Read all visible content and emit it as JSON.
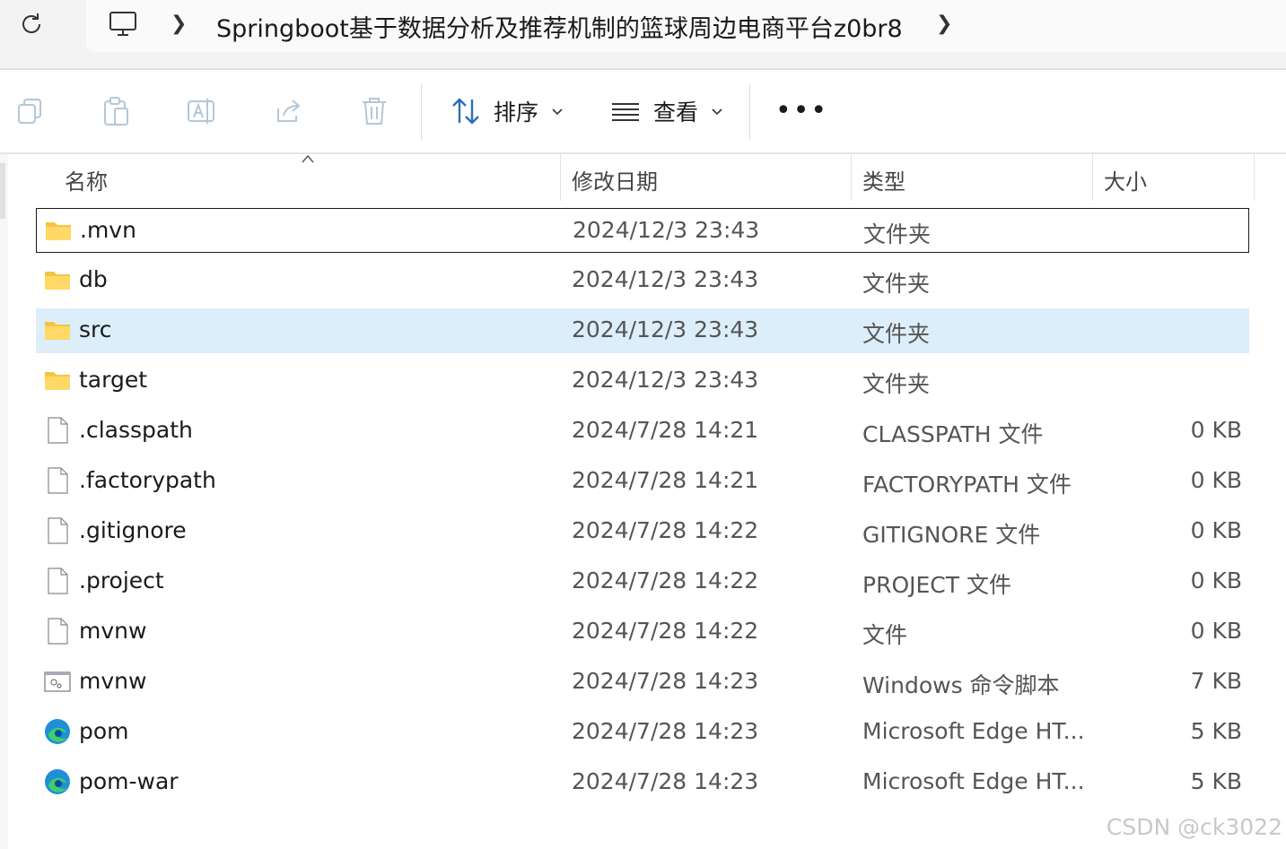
{
  "address": {
    "path_label": "Springboot基于数据分析及推荐机制的篮球周边电商平台z0br8",
    "icons": [
      "refresh-icon",
      "this-pc-icon",
      "chevron-right-icon"
    ]
  },
  "toolbar": {
    "sort_label": "排序",
    "view_label": "查看",
    "more_label": "•••",
    "icons": [
      "copy-icon",
      "paste-icon",
      "rename-icon",
      "share-icon",
      "delete-icon",
      "sort-icon",
      "view-icon"
    ]
  },
  "columns": {
    "name": "名称",
    "date": "修改日期",
    "type": "类型",
    "size": "大小"
  },
  "files": [
    {
      "name": ".mvn",
      "date": "2024/12/3 23:43",
      "type": "文件夹",
      "size": "",
      "icon": "folder-icon"
    },
    {
      "name": "db",
      "date": "2024/12/3 23:43",
      "type": "文件夹",
      "size": "",
      "icon": "folder-icon"
    },
    {
      "name": "src",
      "date": "2024/12/3 23:43",
      "type": "文件夹",
      "size": "",
      "icon": "folder-icon"
    },
    {
      "name": "target",
      "date": "2024/12/3 23:43",
      "type": "文件夹",
      "size": "",
      "icon": "folder-icon"
    },
    {
      "name": ".classpath",
      "date": "2024/7/28 14:21",
      "type": "CLASSPATH 文件",
      "size": "0 KB",
      "icon": "file-icon"
    },
    {
      "name": ".factorypath",
      "date": "2024/7/28 14:21",
      "type": "FACTORYPATH 文件",
      "size": "0 KB",
      "icon": "file-icon"
    },
    {
      "name": ".gitignore",
      "date": "2024/7/28 14:22",
      "type": "GITIGNORE 文件",
      "size": "0 KB",
      "icon": "file-icon"
    },
    {
      "name": ".project",
      "date": "2024/7/28 14:22",
      "type": "PROJECT 文件",
      "size": "0 KB",
      "icon": "file-icon"
    },
    {
      "name": "mvnw",
      "date": "2024/7/28 14:22",
      "type": "文件",
      "size": "0 KB",
      "icon": "file-icon"
    },
    {
      "name": "mvnw",
      "date": "2024/7/28 14:23",
      "type": "Windows 命令脚本",
      "size": "7 KB",
      "icon": "script-icon"
    },
    {
      "name": "pom",
      "date": "2024/7/28 14:23",
      "type": "Microsoft Edge HT...",
      "size": "5 KB",
      "icon": "edge-icon"
    },
    {
      "name": "pom-war",
      "date": "2024/7/28 14:23",
      "type": "Microsoft Edge HT...",
      "size": "5 KB",
      "icon": "edge-icon"
    }
  ],
  "watermark": "CSDN @ck3022",
  "colors": {
    "selected_row": "#ddeefb",
    "folder": "#f5c542"
  }
}
